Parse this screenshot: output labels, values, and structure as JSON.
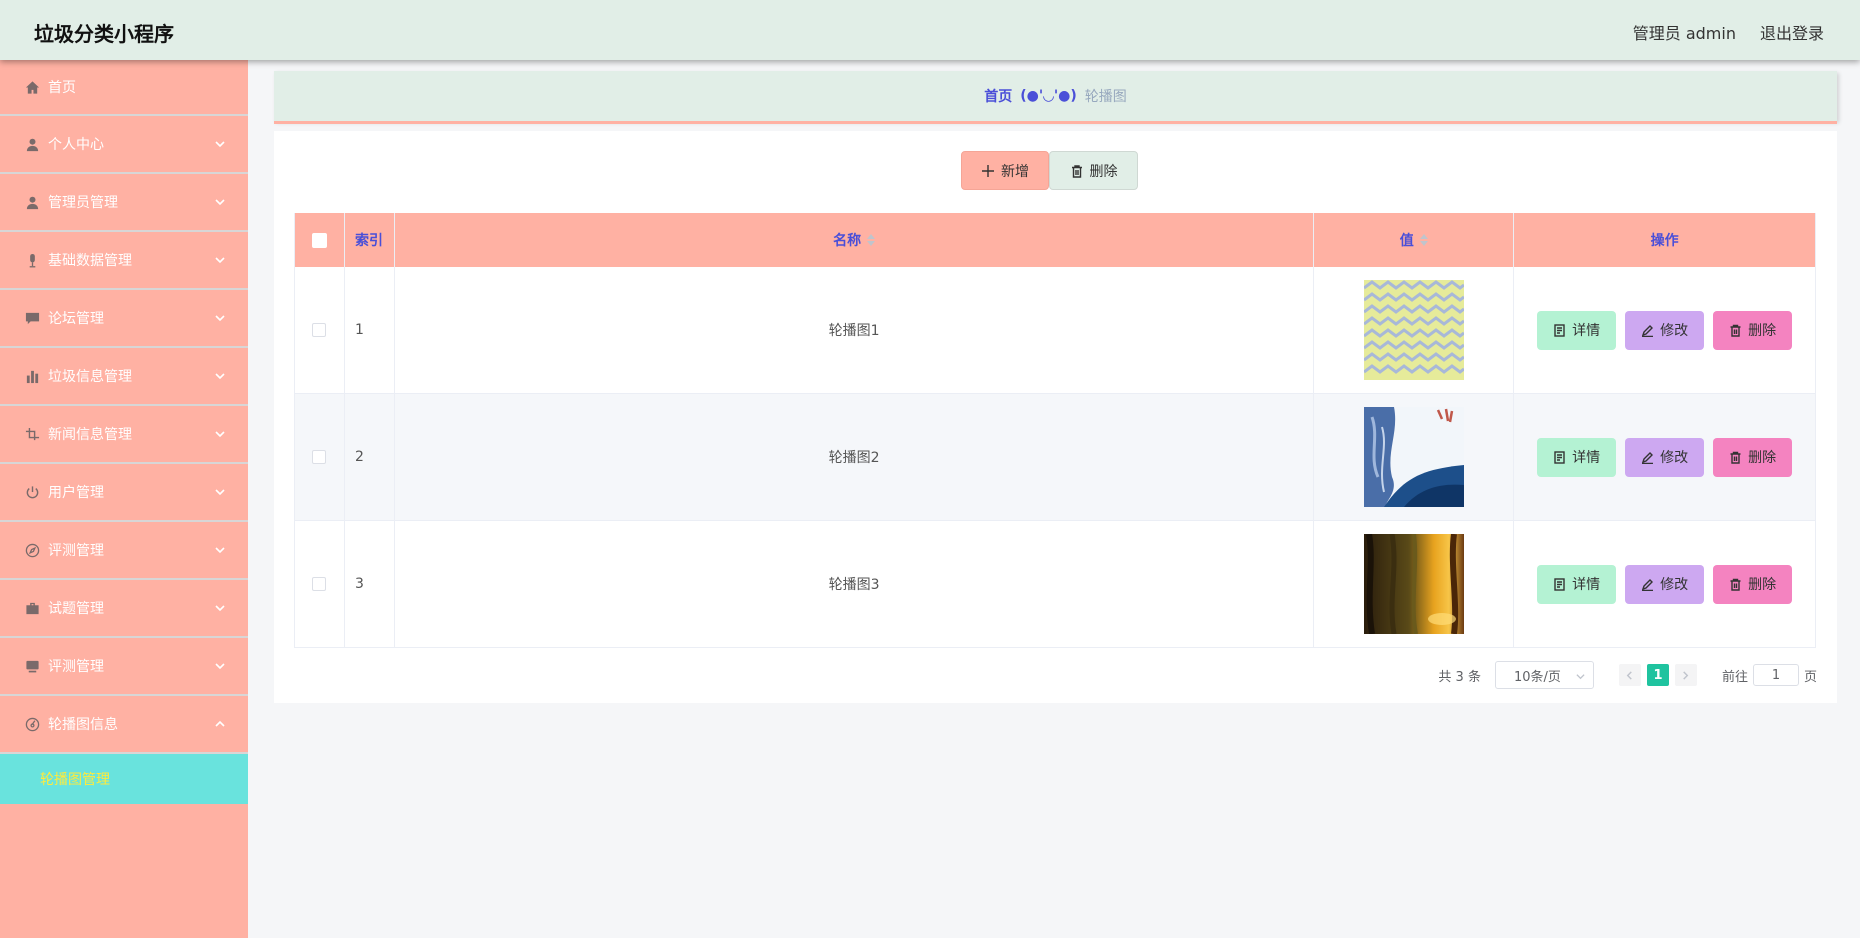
{
  "header": {
    "title": "垃圾分类小程序",
    "user": "管理员 admin",
    "logout": "退出登录"
  },
  "sidebar": {
    "items": [
      {
        "label": "首页",
        "icon": "home-icon"
      },
      {
        "label": "个人中心",
        "icon": "user-icon"
      },
      {
        "label": "管理员管理",
        "icon": "user-icon"
      },
      {
        "label": "基础数据管理",
        "icon": "microphone-icon"
      },
      {
        "label": "论坛管理",
        "icon": "chat-icon"
      },
      {
        "label": "垃圾信息管理",
        "icon": "bar-chart-icon"
      },
      {
        "label": "新闻信息管理",
        "icon": "crop-icon"
      },
      {
        "label": "用户管理",
        "icon": "power-icon"
      },
      {
        "label": "评测管理",
        "icon": "compass-icon"
      },
      {
        "label": "试题管理",
        "icon": "briefcase-icon"
      },
      {
        "label": "评测管理",
        "icon": "monitor-icon"
      },
      {
        "label": "轮播图信息",
        "icon": "dashboard-icon"
      }
    ],
    "active_sub": "轮播图管理"
  },
  "breadcrumb": {
    "home": "首页",
    "separator": "(●'◡'●)",
    "current": "轮播图"
  },
  "toolbar": {
    "add_label": "新增",
    "delete_label": "删除"
  },
  "table": {
    "headers": {
      "index": "索引",
      "name": "名称",
      "value": "值",
      "actions": "操作"
    },
    "rows": [
      {
        "index": "1",
        "name": "轮播图1",
        "image": "zigzag-pattern"
      },
      {
        "index": "2",
        "name": "轮播图2",
        "image": "blue-ink-landscape"
      },
      {
        "index": "3",
        "name": "轮播图3",
        "image": "sunset-forest"
      }
    ],
    "actions": {
      "detail": "详情",
      "edit": "修改",
      "delete": "删除"
    }
  },
  "pagination": {
    "total": "共 3 条",
    "page_size": "10条/页",
    "current_page": "1",
    "goto_prefix": "前往",
    "goto_suffix": "页",
    "goto_value": "1"
  },
  "colors": {
    "header_bg": "#e1eee7",
    "sidebar_bg": "#ffb1a3",
    "active_sub_bg": "#69e3dd",
    "accent": "#4a4fd8",
    "page_active": "#1fc39f"
  }
}
